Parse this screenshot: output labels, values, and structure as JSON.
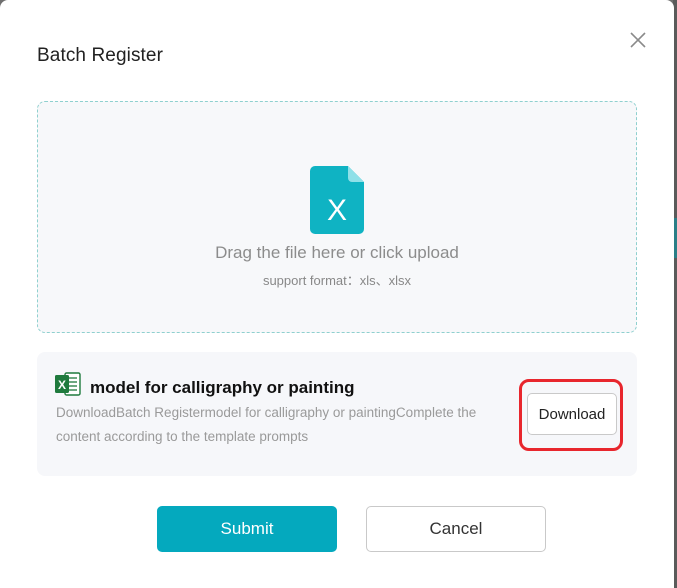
{
  "dialog": {
    "title": "Batch Register",
    "close_icon": "close-icon"
  },
  "upload": {
    "icon": "excel-file-icon",
    "icon_letter": "X",
    "text": "Drag the file here or click upload",
    "hint": "support format：xls、xlsx"
  },
  "template": {
    "icon": "excel-icon",
    "icon_letter": "X",
    "title": "model for calligraphy or painting",
    "description": "DownloadBatch Registermodel for calligraphy or paintingComplete the content according to the template prompts",
    "download_label": "Download"
  },
  "footer": {
    "submit_label": "Submit",
    "cancel_label": "Cancel"
  },
  "colors": {
    "accent": "#04a9be",
    "file_icon": "#0fb3c3",
    "excel_green": "#1f7a3d",
    "highlight": "#e8262d",
    "dashed_border": "#8fd0cf"
  }
}
